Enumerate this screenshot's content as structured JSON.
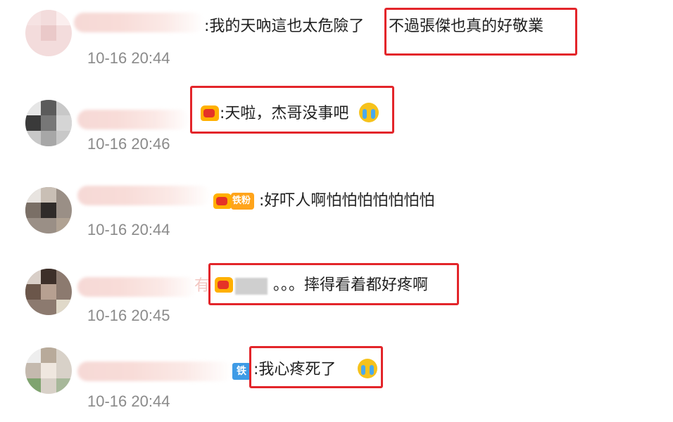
{
  "comments": [
    {
      "text": ":我的天吶這也太危險了",
      "highlight_text": "不過張傑也真的好敬業",
      "time": "10-16 20:44"
    },
    {
      "text": ":天啦，杰哥没事吧",
      "time": "10-16 20:46"
    },
    {
      "badge": "铁粉",
      "text": ":好吓人啊怕怕怕怕怕怕怕",
      "time": "10-16 20:44"
    },
    {
      "prefix": "有",
      "text": "。。。摔得看着都好疼啊",
      "time": "10-16 20:45"
    },
    {
      "badge": "铁",
      "text": ":我心疼死了",
      "time": "10-16 20:44"
    }
  ],
  "colors": {
    "highlight": "#e3252a",
    "text": "#1f1f1f",
    "timestamp": "#8a8a8a"
  },
  "icons": [
    "fan-badge-icon",
    "crying-emoji-icon"
  ]
}
